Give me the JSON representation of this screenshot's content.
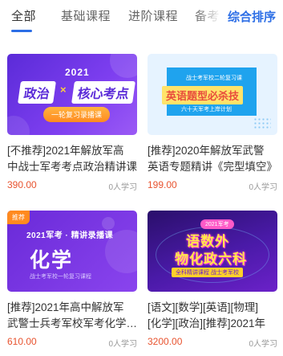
{
  "tabs": [
    "全部",
    "基础课程",
    "进阶课程",
    "备考"
  ],
  "sort_label": "综合排序",
  "colors": {
    "accent": "#2c6ee6",
    "price": "#e8532f"
  },
  "courses": [
    {
      "title_line1": "[不推荐]2021年解放军高",
      "title_line2": "中战士军考考点政治精讲课",
      "price": "390.00",
      "students": "0人学习",
      "thumb": {
        "year": "2021",
        "word1": "政治",
        "x": "×",
        "word2": "核心考点",
        "button": "一轮复习录播课"
      }
    },
    {
      "title_line1": "[推荐]2020年解放军武警",
      "title_line2": "英语专题精讲《完型填空》",
      "price": "199.00",
      "students": "0人学习",
      "thumb": {
        "line1": "战士考军校二轮复习课",
        "main": "英语题型必杀技",
        "line2": "六十天军考上岸计划"
      }
    },
    {
      "title_line1": "[推荐]2021年高中解放军",
      "title_line2": "武警士兵考军校军考化学精讲",
      "price": "610.00",
      "students": "0人学习",
      "thumb": {
        "badge": "推荐",
        "sub": "2021军考 · 精讲录播课",
        "big": "化学",
        "small": "战士考军校一轮复习课程"
      }
    },
    {
      "title_line1": "[语文][数学][英语][物理]",
      "title_line2": "[化学][政治][推荐]2021年",
      "price": "3200.00",
      "students": "0人学习",
      "thumb": {
        "year": "2021军考",
        "w1": "语数外",
        "w2": "物化政六科",
        "strip": "全科精讲课程 战士考军校"
      }
    }
  ]
}
